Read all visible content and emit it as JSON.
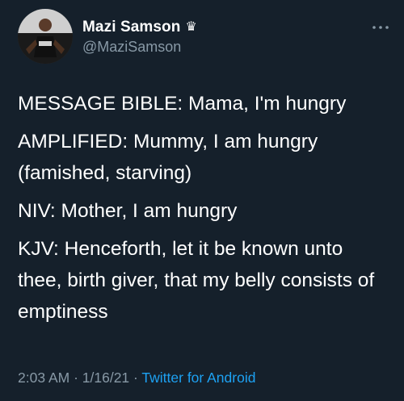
{
  "user": {
    "display_name": "Mazi Samson",
    "handle": "@MaziSamson",
    "badge_icon": "crown-icon"
  },
  "tweet": {
    "paragraphs": [
      "MESSAGE BIBLE: Mama, I'm hungry",
      "AMPLIFIED: Mummy, I am hungry (famished, starving)",
      "NIV: Mother, I am hungry",
      "KJV: Henceforth, let it be known unto thee, birth giver, that my belly consists of emptiness"
    ]
  },
  "meta": {
    "time": "2:03 AM",
    "date": "1/16/21",
    "separator": " · ",
    "source": "Twitter for Android"
  },
  "colors": {
    "background": "#15202b",
    "text": "#ffffff",
    "secondary": "#8899a6",
    "accent": "#1da1f2"
  }
}
